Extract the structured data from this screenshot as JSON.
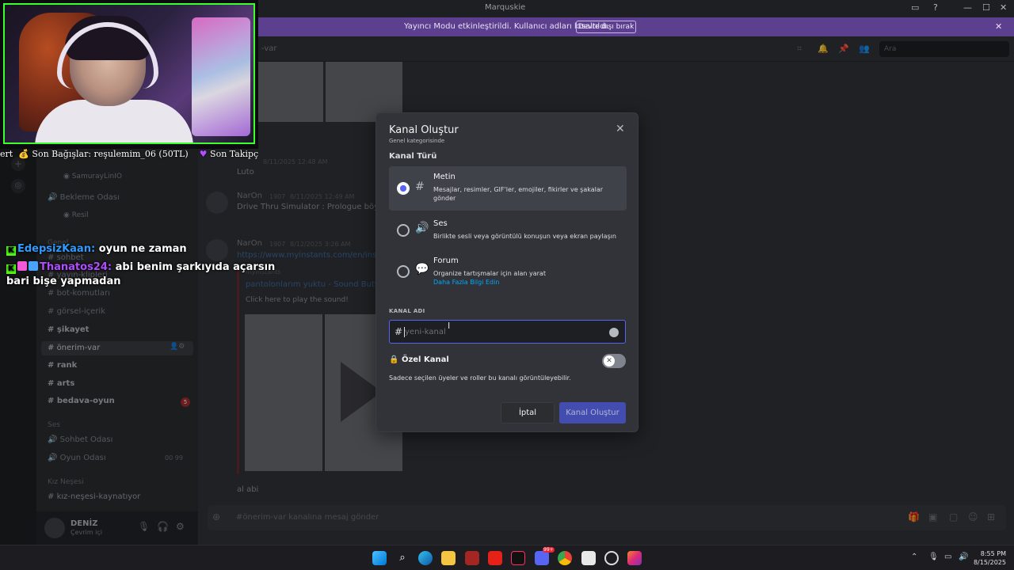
{
  "window": {
    "title": "Marquskie"
  },
  "banner": {
    "message": "Yayıncı Modu etkinleştirildi. Kullanıcı adları kısaltıldı.",
    "disable_button": "Devre dışı bırak"
  },
  "channel_header": {
    "name": "-var",
    "search_placeholder": "Ara"
  },
  "sidebar": {
    "voice_user": "SamurayLinIO",
    "waiting_room": "Bekleme Odası",
    "resil": "Resil",
    "category_general": "Genel",
    "channels": [
      {
        "label": "sohbet"
      },
      {
        "label": "yayın-klipleri"
      },
      {
        "label": "bot-komutları"
      },
      {
        "label": "görsel-içerik"
      },
      {
        "label": "şikayet"
      },
      {
        "label": "önerim-var"
      },
      {
        "label": "rank"
      },
      {
        "label": "arts"
      },
      {
        "label": "bedava-oyun"
      }
    ],
    "bedava_badge": "5",
    "category_voice": "Ses",
    "voice_channels": [
      {
        "label": "Sohbet Odası"
      },
      {
        "label": "Oyun Odası"
      }
    ],
    "oyun_count": "00",
    "oyun_limit": "99",
    "category_kiz": "Kız Neşesi",
    "kiz_channel": "kız-neşesi-kaynatıyor"
  },
  "user": {
    "name": "DENİZ",
    "status": "Çevrim içi"
  },
  "chat": {
    "msg1_time": "8/11/2025 12:48 AM",
    "msg1_text": "Luto",
    "msg2_author": "NarOn",
    "msg2_badge": "1907",
    "msg2_time": "8/11/2025 12:49 AM",
    "msg2_text": "Drive Thru Simulator : Prologue böyle b",
    "msg3_author": "NarOn",
    "msg3_badge": "1907",
    "msg3_time": "8/12/2025 3:26 AM",
    "msg3_link": "https://www.myinstants.com/en/insta",
    "embed_provider": "myinstants",
    "embed_title": "pantolonlarım yuktu - Sound Button",
    "embed_desc": "Click here to play the sound!",
    "last_text": "al abi",
    "composer_placeholder": "#önerim-var kanalına mesaj gönder"
  },
  "modal": {
    "title": "Kanal Oluştur",
    "subtitle": "Genel kategorisinde",
    "type_label": "Kanal Türü",
    "options": [
      {
        "name": "Metin",
        "desc": "Mesajlar, resimler, GIF'ler, emojiler, fikirler ve şakalar gönder",
        "icon": "hash-icon"
      },
      {
        "name": "Ses",
        "desc": "Birlikte sesli veya görüntülü konuşun veya ekran paylaşın",
        "icon": "speaker-icon"
      },
      {
        "name": "Forum",
        "desc": "Organize tartışmalar için alan yarat",
        "link": "Daha Fazla Bilgi Edin",
        "icon": "forum-icon"
      }
    ],
    "selected_option": "Metin",
    "name_label": "KANAL ADI",
    "name_prefix": "#",
    "name_placeholder": "yeni-kanal",
    "name_value": "",
    "private_label": "Özel Kanal",
    "private_desc": "Sadece seçilen üyeler ve roller bu kanalı görüntüleyebilir.",
    "private_enabled": false,
    "cancel_button": "İptal",
    "create_button": "Kanal Oluştur"
  },
  "stream_overlay": {
    "ticker_start": "ert",
    "ticker_donations": "Son Bağışlar: reşulemim_06 (50TL)",
    "ticker_followers": "Son Takipç",
    "chat": [
      {
        "user": "EdepsizKaan:",
        "text": "oyun ne zaman"
      },
      {
        "user": "Thanatos24:",
        "text": "abi benim şarkıyıda açarsın",
        "text2": "bari bişe yapmadan"
      }
    ]
  },
  "taskbar": {
    "time": "8:55 PM",
    "date": "8/15/2025",
    "discord_badge": "99+"
  },
  "colors": {
    "accent": "#5865f2",
    "banner": "#5d3f8f",
    "cam_border": "#3cff2b",
    "kick_green": "#53fc18"
  }
}
